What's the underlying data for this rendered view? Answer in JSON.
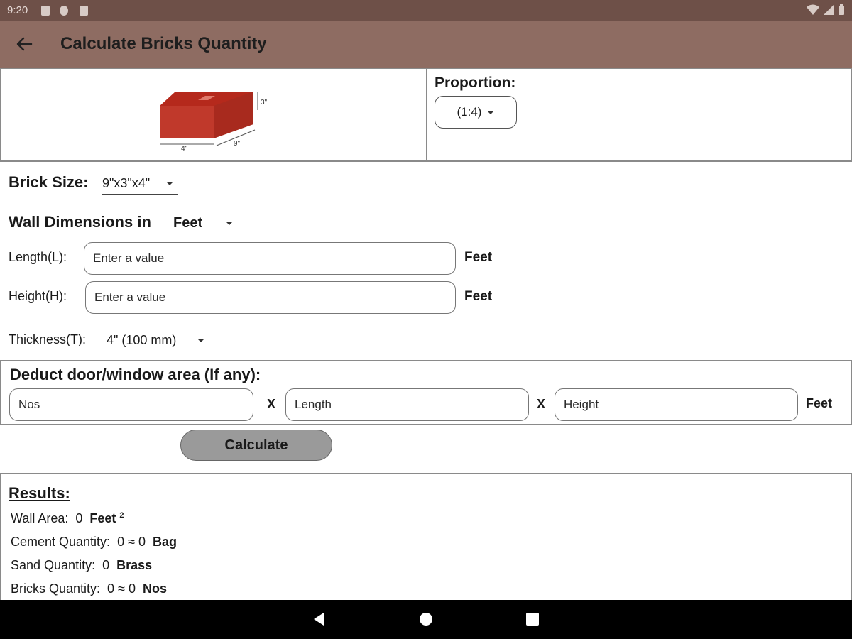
{
  "status_bar": {
    "time": "9:20",
    "icons": [
      "notification-icon",
      "pie-icon",
      "sd-card-icon",
      "wifi-icon",
      "signal-icon",
      "battery-icon"
    ]
  },
  "app_bar": {
    "title": "Calculate Bricks Quantity",
    "back_icon": "arrow-left-icon"
  },
  "brick_image": {
    "dim_height": "3\"",
    "dim_width": "4\"",
    "dim_length": "9\"",
    "color": "#c0392b"
  },
  "proportion": {
    "label": "Proportion:",
    "selected": "(1:4)"
  },
  "brick_size": {
    "label": "Brick Size:",
    "selected": "9\"x3\"x4\""
  },
  "wall_dimensions": {
    "label": "Wall Dimensions in",
    "unit_selected": "Feet",
    "length_label": "Length(L):",
    "length_placeholder": "Enter a value",
    "length_unit": "Feet",
    "height_label": "Height(H):",
    "height_placeholder": "Enter a value",
    "height_unit": "Feet",
    "thickness_label": "Thickness(T):",
    "thickness_selected": "4\" (100 mm)"
  },
  "deduct": {
    "title": "Deduct door/window area (If any):",
    "nos_placeholder": "Nos",
    "x1": "X",
    "length_placeholder": "Length",
    "x2": "X",
    "height_placeholder": "Height",
    "unit": "Feet"
  },
  "calculate_label": "Calculate",
  "results": {
    "title": "Results:",
    "wall_area_label": "Wall Area:",
    "wall_area_value": "0",
    "wall_area_unit": "Feet",
    "wall_area_sup": "2",
    "cement_label": "Cement Quantity:",
    "cement_value": "0 ≈ 0",
    "cement_unit": "Bag",
    "sand_label": "Sand Quantity:",
    "sand_value": "0",
    "sand_unit": "Brass",
    "bricks_label": "Bricks Quantity:",
    "bricks_value": "0 ≈ 0",
    "bricks_unit": "Nos"
  },
  "colors": {
    "status_bar": "#6e5048",
    "app_bar": "#8e6c62",
    "button": "#9a9a9a"
  }
}
